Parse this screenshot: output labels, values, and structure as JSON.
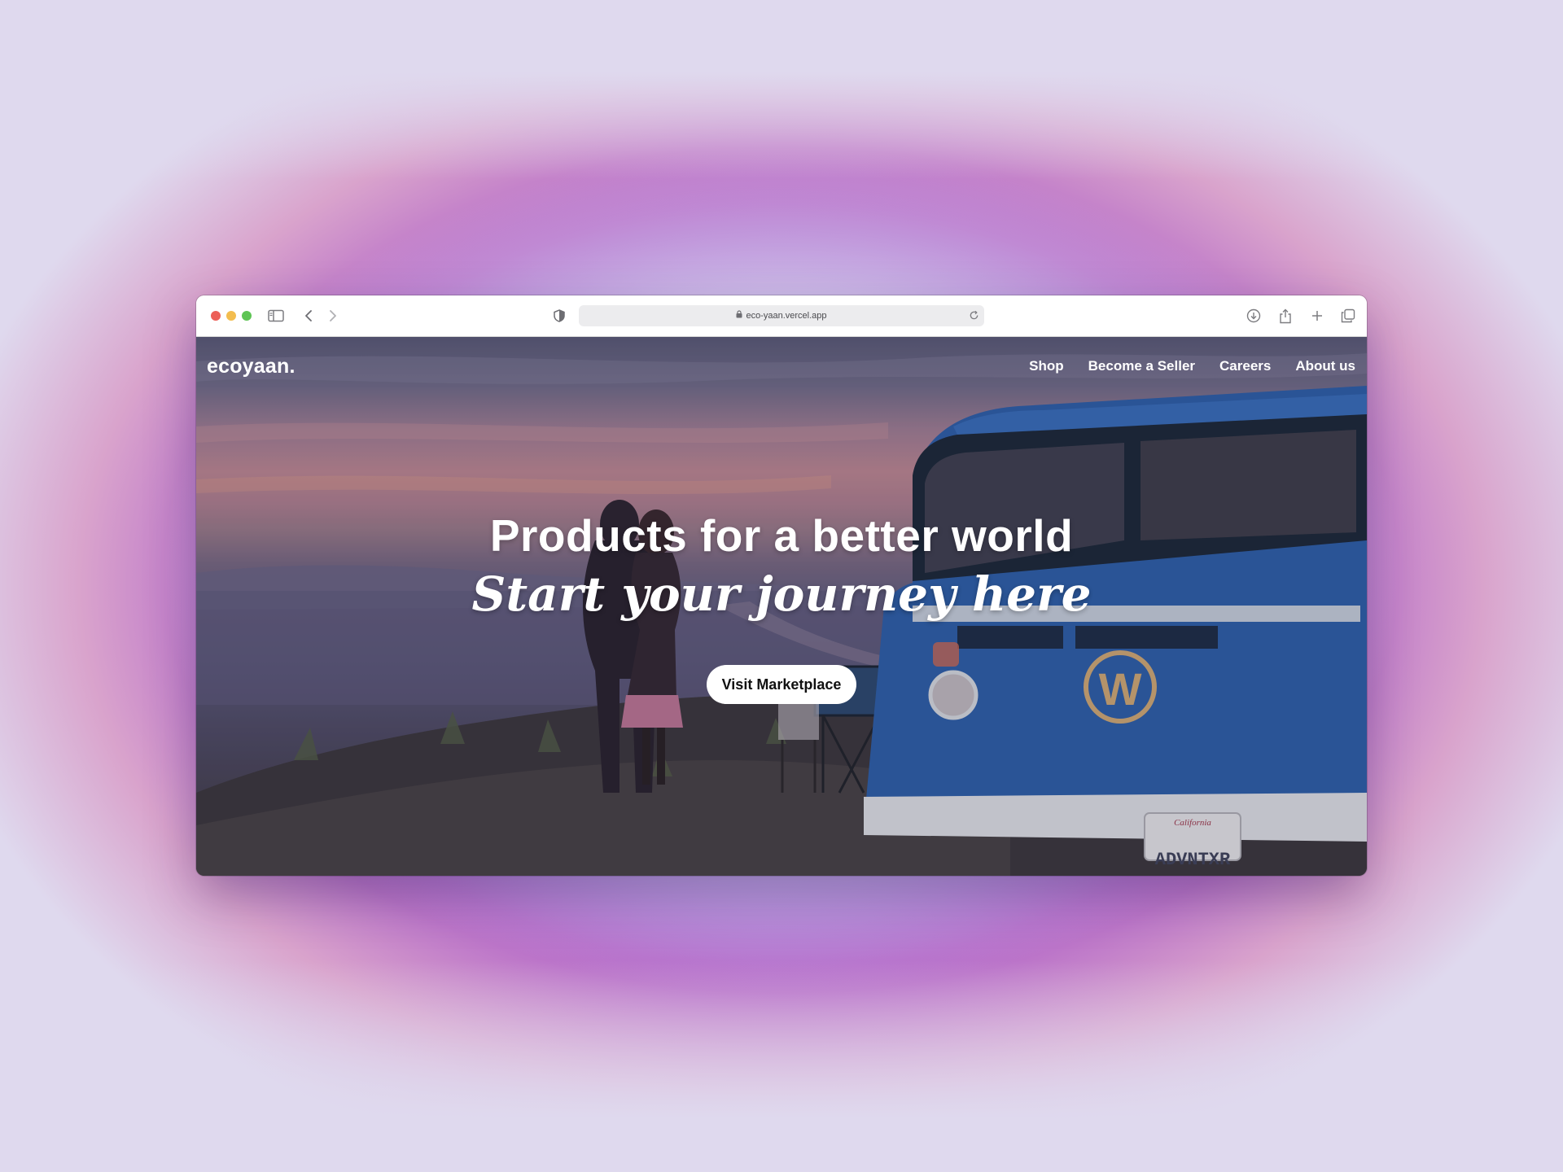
{
  "browser": {
    "url": "eco-yaan.vercel.app",
    "icons": [
      "sidebar-icon",
      "back-icon",
      "forward-icon",
      "shield-icon",
      "lock-icon",
      "reload-icon",
      "download-icon",
      "share-icon",
      "new-tab-icon",
      "tabs-overview-icon"
    ]
  },
  "site": {
    "logo": "ecoyaan.",
    "nav": [
      "Shop",
      "Become a Seller",
      "Careers",
      "About us"
    ],
    "headline": "Products for a better world",
    "subheadline": "Start your journey here",
    "cta": "Visit Marketplace",
    "license_plate": "ADVNTXR"
  },
  "colors": {
    "accent": "#6a45e0",
    "van_blue": "#2f63b0"
  }
}
